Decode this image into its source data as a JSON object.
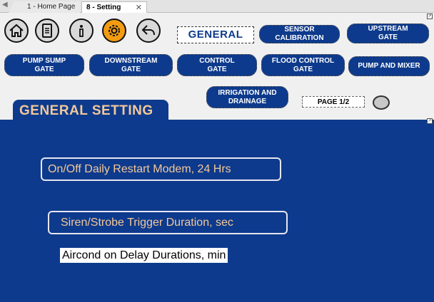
{
  "tabs": [
    {
      "label": "1 - Home Page"
    },
    {
      "label": "8 - Setting"
    }
  ],
  "nav_icons": [
    {
      "name": "home-icon"
    },
    {
      "name": "document-icon"
    },
    {
      "name": "info-icon"
    },
    {
      "name": "gear-icon"
    },
    {
      "name": "back-icon"
    }
  ],
  "current_section_label": "GENERAL",
  "nav_buttons": {
    "sensor_calibration": "SENSOR\nCALIBRATION",
    "upstream_gate": "UPSTREAM\nGATE",
    "pump_sump_gate": "PUMP SUMP\nGATE",
    "downstream_gate": "DOWNSTREAM\nGATE",
    "control_gate": "CONTROL\nGATE",
    "flood_control_gate": "FLOOD CONTROL\nGATE",
    "pump_and_mixer": "PUMP AND MIXER",
    "irrigation_and_drainage": "IRRIGATION AND\nDRAINAGE"
  },
  "page_indicator": "PAGE 1/2",
  "page_title": "GENERAL SETTING",
  "settings": {
    "restart_modem": "On/Off Daily Restart Modem, 24 Hrs",
    "siren_duration": "Siren/Strobe Trigger Duration, sec",
    "aircond_delay": "Aircond on Delay Durations, min"
  },
  "colors": {
    "primary": "#0d3a8c",
    "label_text": "#f3c89a",
    "gear_accent": "#f39c12",
    "background": "#f0f0f0"
  }
}
